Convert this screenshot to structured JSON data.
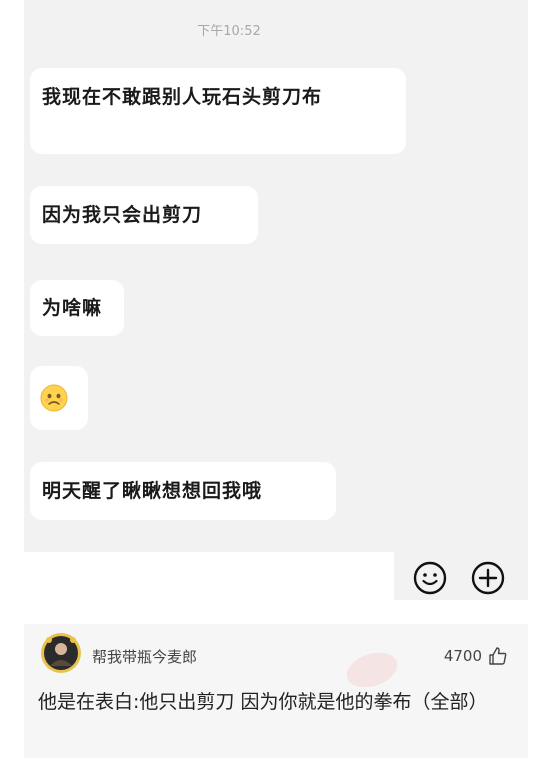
{
  "chat": {
    "time": "下午10:52",
    "messages": [
      {
        "text": "我现在不敢跟别人玩石头剪刀布"
      },
      {
        "text": "因为我只会出剪刀"
      },
      {
        "text": "为啥嘛"
      },
      {
        "emoji": "sad-face-icon"
      },
      {
        "text": "明天醒了瞅瞅想想回我哦"
      }
    ],
    "input_icons": [
      "smile-icon",
      "plus-icon"
    ]
  },
  "comment": {
    "username": "帮我带瓶今麦郎",
    "likes": "4700",
    "text": "他是在表白:他只出剪刀 因为你就是他的拳布（全部）",
    "like_icon": "thumb-up-icon"
  },
  "colors": {
    "chat_bg": "#f2f2f2",
    "bubble_bg": "#ffffff",
    "emoji_yellow": "#ffd34d"
  }
}
